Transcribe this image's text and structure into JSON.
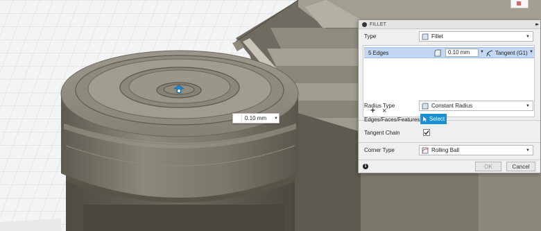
{
  "canvas": {
    "dimension_input": {
      "value": "0.10 mm"
    }
  },
  "dialog": {
    "title": "FILLET",
    "type": {
      "label": "Type",
      "value": "Fillet"
    },
    "edges": {
      "selection_label": "5 Edges",
      "radius_value": "0.10 mm",
      "continuity": "Tangent (G1)",
      "add_label": "+",
      "remove_label": "×"
    },
    "radius_type": {
      "label": "Radius Type",
      "value": "Constant Radius"
    },
    "edges_faces_features": {
      "label": "Edges/Faces/Features",
      "button_label": "Select"
    },
    "tangent_chain": {
      "label": "Tangent Chain",
      "checked": true
    },
    "corner_type": {
      "label": "Corner Type",
      "value": "Rolling Ball"
    },
    "footer": {
      "ok_label": "OK",
      "cancel_label": "Cancel"
    }
  },
  "colors": {
    "selection_highlight": "#c2d8f2",
    "select_button": "#1b8fd3",
    "model_surface": "#7c7769"
  }
}
